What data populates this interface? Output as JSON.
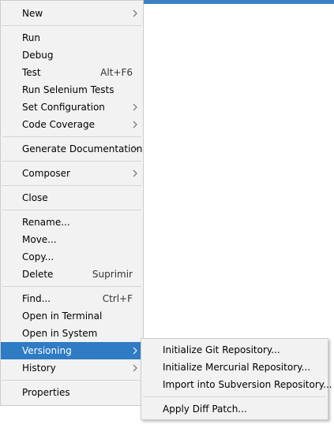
{
  "colors": {
    "accent": "#2f7bc4",
    "menu_background": "#f2f2f2",
    "separator": "#d5d5d5"
  },
  "menu": {
    "new": "New",
    "run": "Run",
    "debug": "Debug",
    "test": "Test",
    "test_shortcut": "Alt+F6",
    "run_selenium_tests": "Run Selenium Tests",
    "set_configuration": "Set Configuration",
    "code_coverage": "Code Coverage",
    "generate_documentation": "Generate Documentation",
    "composer": "Composer",
    "close": "Close",
    "rename": "Rename...",
    "move": "Move...",
    "copy": "Copy...",
    "delete": "Delete",
    "delete_shortcut": "Suprimir",
    "find": "Find...",
    "find_shortcut": "Ctrl+F",
    "open_in_terminal": "Open in Terminal",
    "open_in_system": "Open in System",
    "versioning": "Versioning",
    "history": "History",
    "properties": "Properties"
  },
  "submenu": {
    "init_git": "Initialize Git Repository...",
    "init_mercurial": "Initialize Mercurial Repository...",
    "import_svn": "Import into Subversion Repository...",
    "apply_diff_patch": "Apply Diff Patch..."
  },
  "icons": {
    "submenu_arrow": "chevron-right-icon"
  }
}
